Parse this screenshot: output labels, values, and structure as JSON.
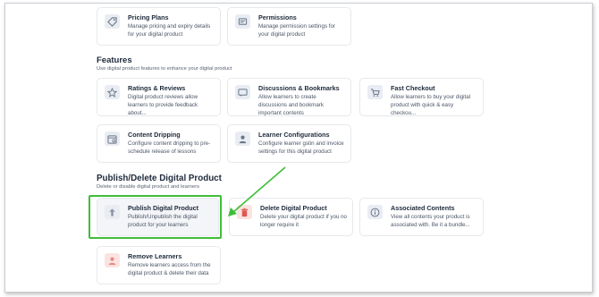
{
  "top_cards": [
    {
      "title": "Pricing Plans",
      "desc": "Manage pricing and expiry details for your digital product",
      "icon": "tag-icon"
    },
    {
      "title": "Permissions",
      "desc": "Manage permission settings for your digital product",
      "icon": "shield-icon"
    }
  ],
  "features": {
    "title": "Features",
    "subtitle": "Use digital product features to enhance your digital product",
    "cards": [
      {
        "title": "Ratings & Reviews",
        "desc": "Digital product reviews allow learners to provide feedback about...",
        "icon": "star-icon"
      },
      {
        "title": "Discussions & Bookmarks",
        "desc": "Allow learners to create discussions and bookmark important contents",
        "icon": "chat-icon"
      },
      {
        "title": "Fast Checkout",
        "desc": "Allow learners to buy your digital product with quick & easy checkou...",
        "icon": "cart-icon"
      },
      {
        "title": "Content Dripping",
        "desc": "Configure content dripping to pre-schedule release of lessons",
        "icon": "calendar-icon"
      },
      {
        "title": "Learner Configurations",
        "desc": "Configure learner gstin and invoice settings for this digital product",
        "icon": "user-icon"
      }
    ]
  },
  "publish": {
    "title": "Publish/Delete Digital Product",
    "subtitle": "Delete or disable digital product and learners",
    "cards": [
      {
        "title": "Publish Digital Product",
        "desc": "Publish/Unpublish the digital product for your learners",
        "icon": "upload-icon"
      },
      {
        "title": "Delete Digital Product",
        "desc": "Delete your digital product if you no longer require it",
        "icon": "trash-icon"
      },
      {
        "title": "Associated Contents",
        "desc": "View all contents your product is associated with. Be it a bundle...",
        "icon": "info-icon"
      },
      {
        "title": "Remove Learners",
        "desc": "Remove learners access from the digital product & delete their data",
        "icon": "user-remove-icon"
      }
    ]
  },
  "colors": {
    "highlight": "#3fbe3a",
    "arrow": "#3fbe3a",
    "delete_icon": "#e0574f",
    "remove_icon": "#e88a82"
  }
}
